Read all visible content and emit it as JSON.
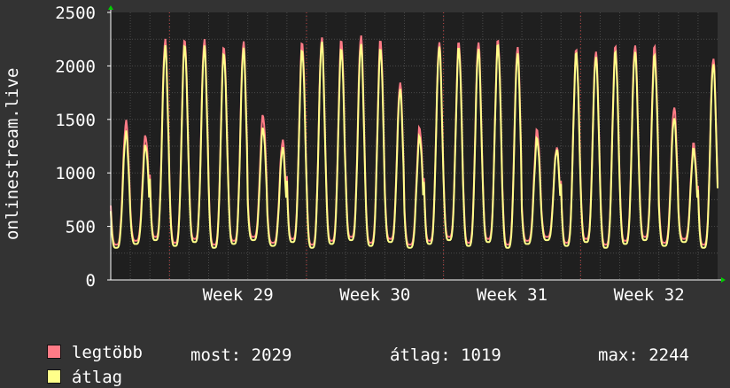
{
  "chart_data": {
    "type": "line",
    "ylabel": "onlinestream.live",
    "ylim": [
      0,
      2500
    ],
    "yticks": [
      0,
      500,
      1000,
      1500,
      2000,
      2500
    ],
    "xtick_labels": [
      "Week 29",
      "Week 30",
      "Week 31",
      "Week 32"
    ],
    "grid": true,
    "days": 31,
    "daily_peak_max": [
      1480,
      1350,
      2240,
      2250,
      2240,
      2180,
      2220,
      1540,
      1300,
      2220,
      2260,
      2240,
      2280,
      2240,
      1840,
      1420,
      2220,
      2220,
      2220,
      2240,
      2180,
      1400,
      1240,
      2150,
      2140,
      2180,
      2200,
      2180,
      1620,
      1270,
      2080
    ],
    "daily_peak_avg": [
      1380,
      1260,
      2180,
      2200,
      2180,
      2120,
      2160,
      1420,
      1230,
      2150,
      2220,
      2160,
      2200,
      2160,
      1780,
      1340,
      2180,
      2170,
      2160,
      2200,
      2120,
      1320,
      1220,
      2120,
      2090,
      2130,
      2140,
      2100,
      1520,
      1220,
      2029
    ],
    "series": [
      {
        "name": "legtöbb",
        "color": "#ff7b86"
      },
      {
        "name": "átlag",
        "color": "#ffff8a"
      }
    ]
  },
  "legend": {
    "max_label": "legtöbb",
    "avg_label": "átlag",
    "stats": {
      "now": "most: 2029",
      "avg": "átlag: 1019",
      "max": "max: 2244"
    }
  },
  "colors": {
    "background": "#333333",
    "plot_background": "#1f1f1f",
    "grid": "#4a4a4a",
    "minor_grid": "#c04040",
    "axis": "#ffffff",
    "arrow": "#00cc00"
  }
}
